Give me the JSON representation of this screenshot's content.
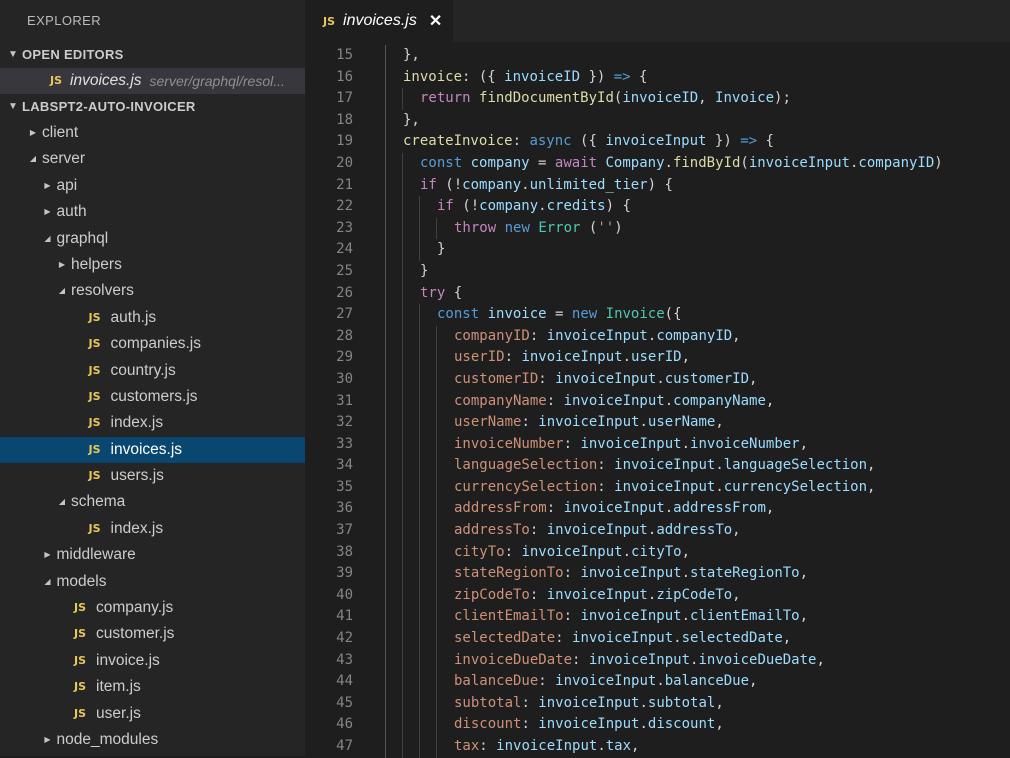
{
  "sidebar": {
    "title": "EXPLORER",
    "open_editors_label": "OPEN EDITORS",
    "open_editor": {
      "badge": "JS",
      "name": "invoices.js",
      "path": "server/graphql/resol..."
    },
    "project_label": "LABSPT2-AUTO-INVOICER",
    "tree": [
      {
        "label": "client",
        "type": "folder",
        "expanded": false,
        "depth": 0
      },
      {
        "label": "server",
        "type": "folder",
        "expanded": true,
        "depth": 0
      },
      {
        "label": "api",
        "type": "folder",
        "expanded": false,
        "depth": 1
      },
      {
        "label": "auth",
        "type": "folder",
        "expanded": false,
        "depth": 1
      },
      {
        "label": "graphql",
        "type": "folder",
        "expanded": true,
        "depth": 1
      },
      {
        "label": "helpers",
        "type": "folder",
        "expanded": false,
        "depth": 2
      },
      {
        "label": "resolvers",
        "type": "folder",
        "expanded": true,
        "depth": 2
      },
      {
        "label": "auth.js",
        "type": "file",
        "depth": 3
      },
      {
        "label": "companies.js",
        "type": "file",
        "depth": 3
      },
      {
        "label": "country.js",
        "type": "file",
        "depth": 3
      },
      {
        "label": "customers.js",
        "type": "file",
        "depth": 3
      },
      {
        "label": "index.js",
        "type": "file",
        "depth": 3
      },
      {
        "label": "invoices.js",
        "type": "file",
        "depth": 3,
        "selected": true
      },
      {
        "label": "users.js",
        "type": "file",
        "depth": 3
      },
      {
        "label": "schema",
        "type": "folder",
        "expanded": true,
        "depth": 2
      },
      {
        "label": "index.js",
        "type": "file",
        "depth": 3
      },
      {
        "label": "middleware",
        "type": "folder",
        "expanded": false,
        "depth": 1
      },
      {
        "label": "models",
        "type": "folder",
        "expanded": true,
        "depth": 1
      },
      {
        "label": "company.js",
        "type": "file",
        "depth": 2
      },
      {
        "label": "customer.js",
        "type": "file",
        "depth": 2
      },
      {
        "label": "invoice.js",
        "type": "file",
        "depth": 2
      },
      {
        "label": "item.js",
        "type": "file",
        "depth": 2
      },
      {
        "label": "user.js",
        "type": "file",
        "depth": 2
      },
      {
        "label": "node_modules",
        "type": "folder",
        "expanded": false,
        "depth": 1
      }
    ]
  },
  "tab": {
    "badge": "JS",
    "name": "invoices.js",
    "close": "✕"
  },
  "colors": {
    "selection": "#094771",
    "badge": "#e8c85b",
    "background": "#1e1e1e",
    "sidebar": "#252526"
  },
  "code": [
    {
      "n": "15",
      "indent": 0,
      "tokens": [
        [
          "p",
          "},"
        ]
      ]
    },
    {
      "n": "16",
      "indent": 0,
      "tokens": [
        [
          "fn",
          "invoice"
        ],
        [
          "p",
          ": ({ "
        ],
        [
          "var",
          "invoiceID"
        ],
        [
          "p",
          " }) "
        ],
        [
          "kw",
          "=>"
        ],
        [
          "p",
          " {"
        ]
      ]
    },
    {
      "n": "17",
      "indent": 1,
      "tokens": [
        [
          "ctl",
          "return"
        ],
        [
          "p",
          " "
        ],
        [
          "fn",
          "findDocumentById"
        ],
        [
          "p",
          "("
        ],
        [
          "var",
          "invoiceID"
        ],
        [
          "p",
          ", "
        ],
        [
          "var",
          "Invoice"
        ],
        [
          "p",
          ");"
        ]
      ]
    },
    {
      "n": "18",
      "indent": 0,
      "tokens": [
        [
          "p",
          "},"
        ]
      ]
    },
    {
      "n": "19",
      "indent": 0,
      "tokens": [
        [
          "fn",
          "createInvoice"
        ],
        [
          "p",
          ": "
        ],
        [
          "kw",
          "async"
        ],
        [
          "p",
          " ({ "
        ],
        [
          "var",
          "invoiceInput"
        ],
        [
          "p",
          " }) "
        ],
        [
          "kw",
          "=>"
        ],
        [
          "p",
          " {"
        ]
      ]
    },
    {
      "n": "20",
      "indent": 1,
      "tokens": [
        [
          "kw",
          "const"
        ],
        [
          "p",
          " "
        ],
        [
          "var",
          "company"
        ],
        [
          "p",
          " = "
        ],
        [
          "ctl",
          "await"
        ],
        [
          "p",
          " "
        ],
        [
          "var",
          "Company"
        ],
        [
          "p",
          "."
        ],
        [
          "fn",
          "findById"
        ],
        [
          "p",
          "("
        ],
        [
          "var",
          "invoiceInput"
        ],
        [
          "p",
          "."
        ],
        [
          "var",
          "companyID"
        ],
        [
          "p",
          ")"
        ]
      ]
    },
    {
      "n": "21",
      "indent": 1,
      "tokens": [
        [
          "ctl",
          "if"
        ],
        [
          "p",
          " (!"
        ],
        [
          "var",
          "company"
        ],
        [
          "p",
          "."
        ],
        [
          "var",
          "unlimited_tier"
        ],
        [
          "p",
          ") {"
        ]
      ]
    },
    {
      "n": "22",
      "indent": 2,
      "tokens": [
        [
          "ctl",
          "if"
        ],
        [
          "p",
          " (!"
        ],
        [
          "var",
          "company"
        ],
        [
          "p",
          "."
        ],
        [
          "var",
          "credits"
        ],
        [
          "p",
          ") {"
        ]
      ]
    },
    {
      "n": "23",
      "indent": 3,
      "tokens": [
        [
          "ctl",
          "throw"
        ],
        [
          "p",
          " "
        ],
        [
          "kw",
          "new"
        ],
        [
          "p",
          " "
        ],
        [
          "cls",
          "Error"
        ],
        [
          "p",
          " ("
        ],
        [
          "str",
          "''"
        ],
        [
          "p",
          ")"
        ]
      ]
    },
    {
      "n": "24",
      "indent": 2,
      "tokens": [
        [
          "p",
          "}"
        ]
      ]
    },
    {
      "n": "25",
      "indent": 1,
      "tokens": [
        [
          "p",
          "}"
        ]
      ]
    },
    {
      "n": "26",
      "indent": 1,
      "tokens": [
        [
          "ctl",
          "try"
        ],
        [
          "p",
          " {"
        ]
      ]
    },
    {
      "n": "27",
      "indent": 2,
      "tokens": [
        [
          "kw",
          "const"
        ],
        [
          "p",
          " "
        ],
        [
          "var",
          "invoice"
        ],
        [
          "p",
          " = "
        ],
        [
          "kw",
          "new"
        ],
        [
          "p",
          " "
        ],
        [
          "cls",
          "Invoice"
        ],
        [
          "p",
          "({"
        ]
      ]
    },
    {
      "n": "28",
      "indent": 3,
      "tokens": [
        [
          "prop",
          "companyID"
        ],
        [
          "p",
          ": "
        ],
        [
          "var",
          "invoiceInput"
        ],
        [
          "p",
          "."
        ],
        [
          "var",
          "companyID"
        ],
        [
          "p",
          ","
        ]
      ]
    },
    {
      "n": "29",
      "indent": 3,
      "tokens": [
        [
          "prop",
          "userID"
        ],
        [
          "p",
          ": "
        ],
        [
          "var",
          "invoiceInput"
        ],
        [
          "p",
          "."
        ],
        [
          "var",
          "userID"
        ],
        [
          "p",
          ","
        ]
      ]
    },
    {
      "n": "30",
      "indent": 3,
      "tokens": [
        [
          "prop",
          "customerID"
        ],
        [
          "p",
          ": "
        ],
        [
          "var",
          "invoiceInput"
        ],
        [
          "p",
          "."
        ],
        [
          "var",
          "customerID"
        ],
        [
          "p",
          ","
        ]
      ]
    },
    {
      "n": "31",
      "indent": 3,
      "tokens": [
        [
          "prop",
          "companyName"
        ],
        [
          "p",
          ": "
        ],
        [
          "var",
          "invoiceInput"
        ],
        [
          "p",
          "."
        ],
        [
          "var",
          "companyName"
        ],
        [
          "p",
          ","
        ]
      ]
    },
    {
      "n": "32",
      "indent": 3,
      "tokens": [
        [
          "prop",
          "userName"
        ],
        [
          "p",
          ": "
        ],
        [
          "var",
          "invoiceInput"
        ],
        [
          "p",
          "."
        ],
        [
          "var",
          "userName"
        ],
        [
          "p",
          ","
        ]
      ]
    },
    {
      "n": "33",
      "indent": 3,
      "tokens": [
        [
          "prop",
          "invoiceNumber"
        ],
        [
          "p",
          ": "
        ],
        [
          "var",
          "invoiceInput"
        ],
        [
          "p",
          "."
        ],
        [
          "var",
          "invoiceNumber"
        ],
        [
          "p",
          ","
        ]
      ]
    },
    {
      "n": "34",
      "indent": 3,
      "tokens": [
        [
          "prop",
          "languageSelection"
        ],
        [
          "p",
          ": "
        ],
        [
          "var",
          "invoiceInput"
        ],
        [
          "p",
          "."
        ],
        [
          "var",
          "languageSelection"
        ],
        [
          "p",
          ","
        ]
      ]
    },
    {
      "n": "35",
      "indent": 3,
      "tokens": [
        [
          "prop",
          "currencySelection"
        ],
        [
          "p",
          ": "
        ],
        [
          "var",
          "invoiceInput"
        ],
        [
          "p",
          "."
        ],
        [
          "var",
          "currencySelection"
        ],
        [
          "p",
          ","
        ]
      ]
    },
    {
      "n": "36",
      "indent": 3,
      "tokens": [
        [
          "prop",
          "addressFrom"
        ],
        [
          "p",
          ": "
        ],
        [
          "var",
          "invoiceInput"
        ],
        [
          "p",
          "."
        ],
        [
          "var",
          "addressFrom"
        ],
        [
          "p",
          ","
        ]
      ]
    },
    {
      "n": "37",
      "indent": 3,
      "tokens": [
        [
          "prop",
          "addressTo"
        ],
        [
          "p",
          ": "
        ],
        [
          "var",
          "invoiceInput"
        ],
        [
          "p",
          "."
        ],
        [
          "var",
          "addressTo"
        ],
        [
          "p",
          ","
        ]
      ]
    },
    {
      "n": "38",
      "indent": 3,
      "tokens": [
        [
          "prop",
          "cityTo"
        ],
        [
          "p",
          ": "
        ],
        [
          "var",
          "invoiceInput"
        ],
        [
          "p",
          "."
        ],
        [
          "var",
          "cityTo"
        ],
        [
          "p",
          ","
        ]
      ]
    },
    {
      "n": "39",
      "indent": 3,
      "tokens": [
        [
          "prop",
          "stateRegionTo"
        ],
        [
          "p",
          ": "
        ],
        [
          "var",
          "invoiceInput"
        ],
        [
          "p",
          "."
        ],
        [
          "var",
          "stateRegionTo"
        ],
        [
          "p",
          ","
        ]
      ]
    },
    {
      "n": "40",
      "indent": 3,
      "tokens": [
        [
          "prop",
          "zipCodeTo"
        ],
        [
          "p",
          ": "
        ],
        [
          "var",
          "invoiceInput"
        ],
        [
          "p",
          "."
        ],
        [
          "var",
          "zipCodeTo"
        ],
        [
          "p",
          ","
        ]
      ]
    },
    {
      "n": "41",
      "indent": 3,
      "tokens": [
        [
          "prop",
          "clientEmailTo"
        ],
        [
          "p",
          ": "
        ],
        [
          "var",
          "invoiceInput"
        ],
        [
          "p",
          "."
        ],
        [
          "var",
          "clientEmailTo"
        ],
        [
          "p",
          ","
        ]
      ]
    },
    {
      "n": "42",
      "indent": 3,
      "tokens": [
        [
          "prop",
          "selectedDate"
        ],
        [
          "p",
          ": "
        ],
        [
          "var",
          "invoiceInput"
        ],
        [
          "p",
          "."
        ],
        [
          "var",
          "selectedDate"
        ],
        [
          "p",
          ","
        ]
      ]
    },
    {
      "n": "43",
      "indent": 3,
      "tokens": [
        [
          "prop",
          "invoiceDueDate"
        ],
        [
          "p",
          ": "
        ],
        [
          "var",
          "invoiceInput"
        ],
        [
          "p",
          "."
        ],
        [
          "var",
          "invoiceDueDate"
        ],
        [
          "p",
          ","
        ]
      ]
    },
    {
      "n": "44",
      "indent": 3,
      "tokens": [
        [
          "prop",
          "balanceDue"
        ],
        [
          "p",
          ": "
        ],
        [
          "var",
          "invoiceInput"
        ],
        [
          "p",
          "."
        ],
        [
          "var",
          "balanceDue"
        ],
        [
          "p",
          ","
        ]
      ]
    },
    {
      "n": "45",
      "indent": 3,
      "tokens": [
        [
          "prop",
          "subtotal"
        ],
        [
          "p",
          ": "
        ],
        [
          "var",
          "invoiceInput"
        ],
        [
          "p",
          "."
        ],
        [
          "var",
          "subtotal"
        ],
        [
          "p",
          ","
        ]
      ]
    },
    {
      "n": "46",
      "indent": 3,
      "tokens": [
        [
          "prop",
          "discount"
        ],
        [
          "p",
          ": "
        ],
        [
          "var",
          "invoiceInput"
        ],
        [
          "p",
          "."
        ],
        [
          "var",
          "discount"
        ],
        [
          "p",
          ","
        ]
      ]
    },
    {
      "n": "47",
      "indent": 3,
      "tokens": [
        [
          "prop",
          "tax"
        ],
        [
          "p",
          ": "
        ],
        [
          "var",
          "invoiceInput"
        ],
        [
          "p",
          "."
        ],
        [
          "var",
          "tax"
        ],
        [
          "p",
          ","
        ]
      ]
    }
  ]
}
